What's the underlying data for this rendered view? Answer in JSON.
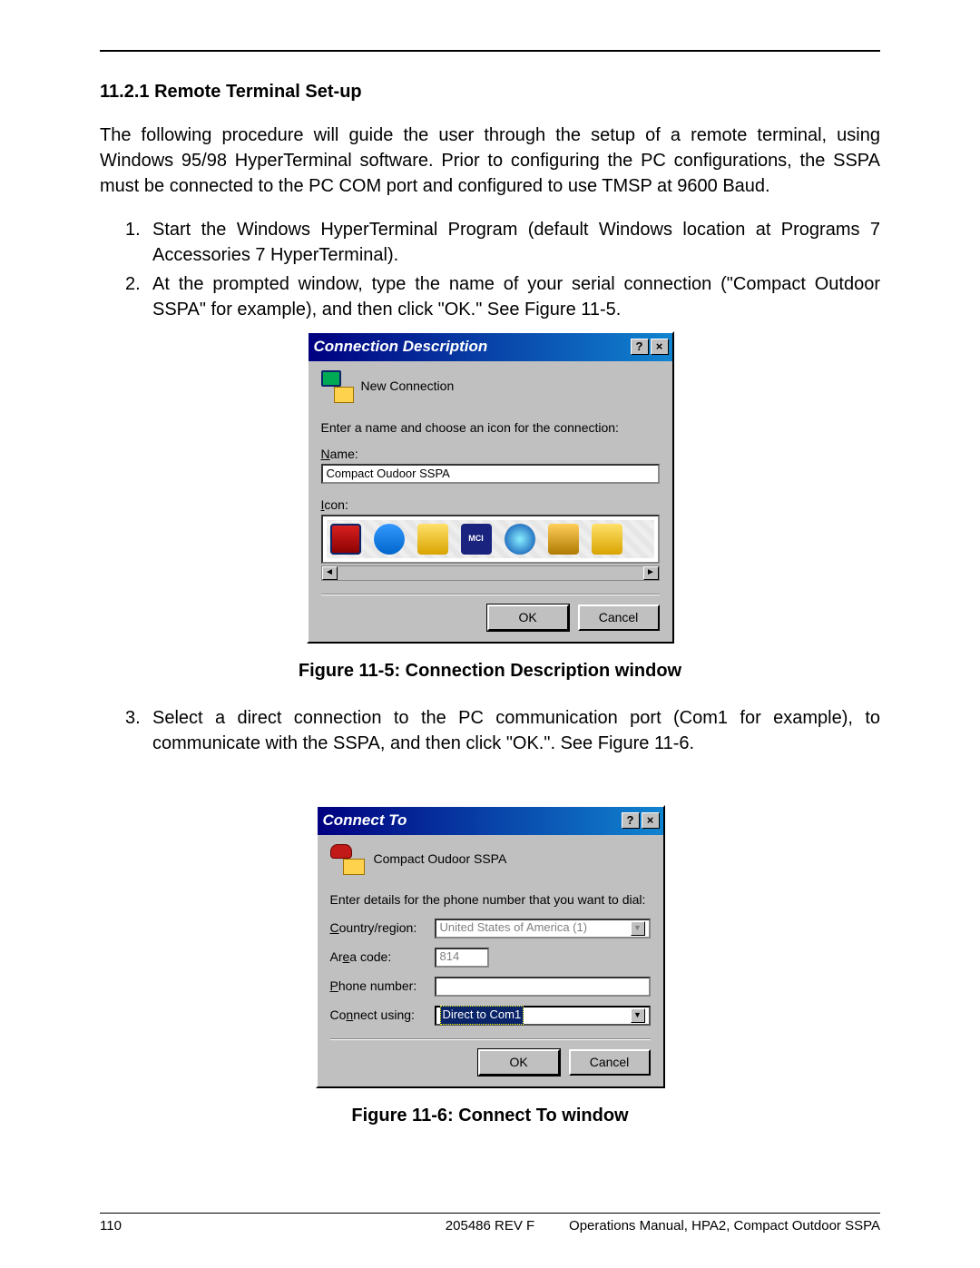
{
  "section": {
    "number": "11.2.1",
    "title": "Remote Terminal Set-up"
  },
  "intro": "The following procedure will guide the user through the setup of a remote terminal, using Windows 95/98 HyperTerminal software. Prior to configuring the PC configurations, the SSPA must be connected to the PC COM port and configured to use TMSP at 9600 Baud.",
  "steps": {
    "s1": "Start the Windows HyperTerminal Program (default Windows location at Programs 7 Accessories 7 HyperTerminal).",
    "s2": "At the prompted window, type the name of your serial connection (\"Compact Outdoor SSPA\" for example), and then click \"OK.\" See Figure 11-5.",
    "s3": "Select a direct connection to the PC communication port (Com1 for example), to communicate with the SSPA, and then click \"OK.\". See Figure 11-6."
  },
  "dlg1": {
    "title": "Connection Description",
    "new_conn": "New Connection",
    "instruction": "Enter a name and choose an icon for the connection:",
    "name_label": "Name:",
    "name_value": "Compact Oudoor SSPA",
    "icon_label": "Icon:",
    "ok": "OK",
    "cancel": "Cancel"
  },
  "fig1_caption": "Figure 11-5: Connection Description window",
  "dlg2": {
    "title": "Connect To",
    "conn_name": "Compact Oudoor SSPA",
    "instruction": "Enter details for the phone number that you want to dial:",
    "country_label": "Country/region:",
    "country_value": "United States of America (1)",
    "area_label": "Area code:",
    "area_value": "814",
    "phone_label": "Phone number:",
    "phone_value": "",
    "connect_label": "Connect using:",
    "connect_value": "Direct to Com1",
    "ok": "OK",
    "cancel": "Cancel"
  },
  "fig2_caption": "Figure 11-6: Connect To window",
  "footer": {
    "left": "110",
    "mid": "205486 REV F",
    "right": "Operations Manual, HPA2, Compact Outdoor SSPA"
  }
}
